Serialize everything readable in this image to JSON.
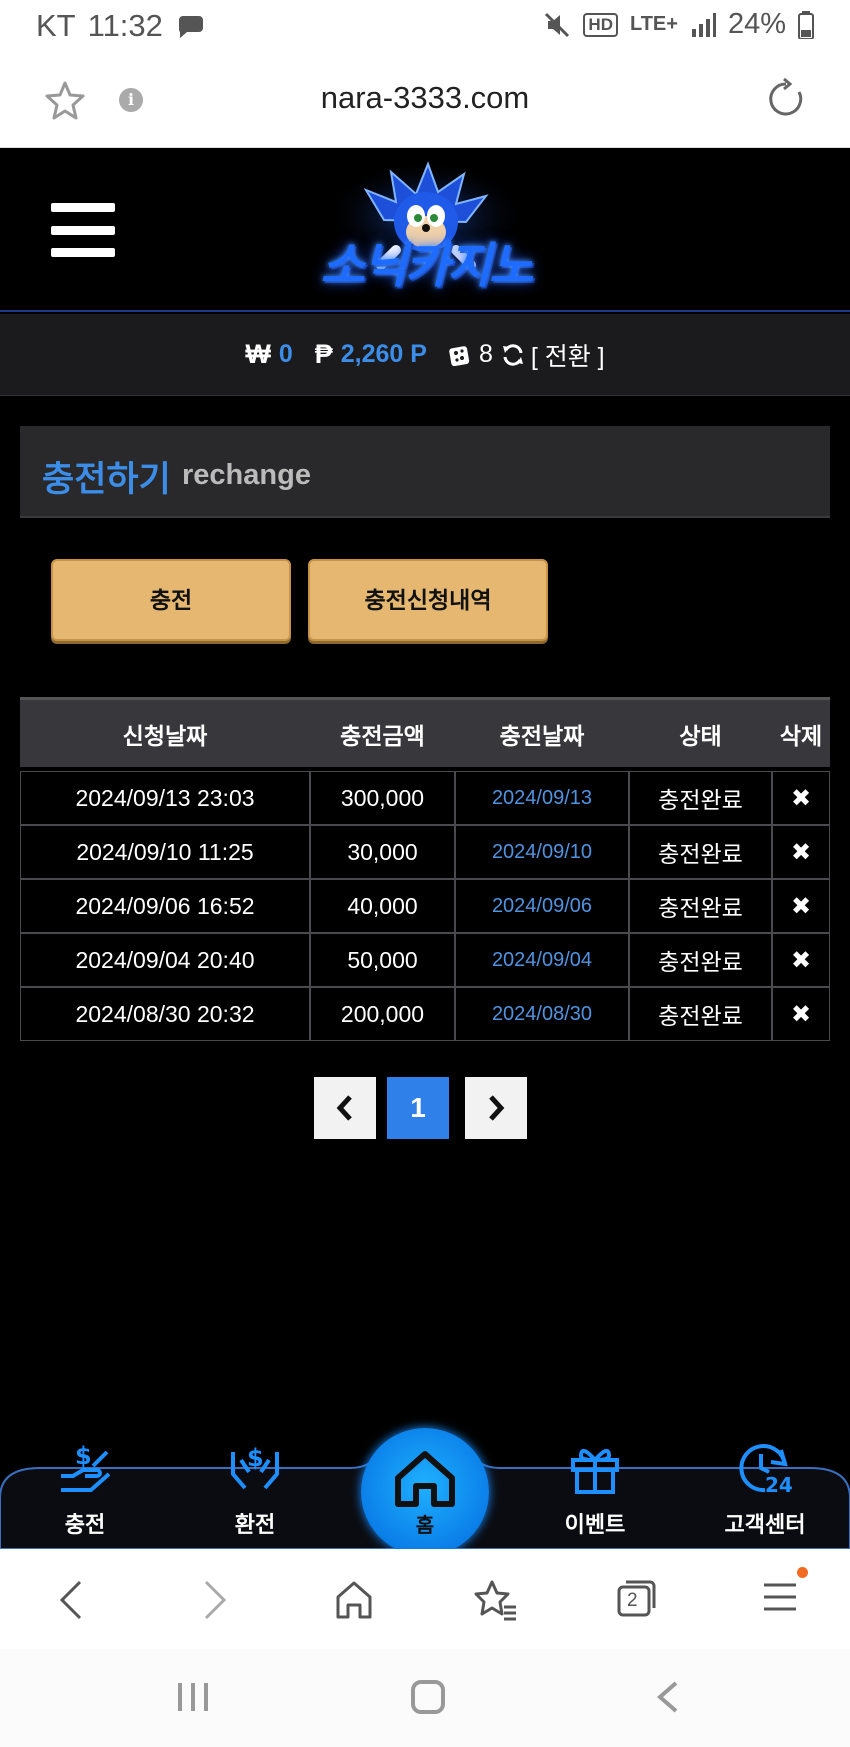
{
  "status_bar": {
    "carrier": "KT",
    "time": "11:32",
    "battery": "24%",
    "network": "LTE+"
  },
  "browser": {
    "url": "nara-3333.com"
  },
  "site": {
    "logo_text": "소닉카지노"
  },
  "balance": {
    "won_symbol": "₩",
    "won_value": "0",
    "point_symbol": "₱",
    "point_value": "2,260 P",
    "ticket_value": "8",
    "swap_label": "[ 전환 ]"
  },
  "page": {
    "title": "충전하기",
    "subtitle": "rechange"
  },
  "actions": {
    "charge_label": "충전",
    "history_label": "충전신청내역"
  },
  "table": {
    "headers": [
      "신청날짜",
      "충전금액",
      "충전날짜",
      "상태",
      "삭제"
    ],
    "rows": [
      {
        "requested": "2024/09/13 23:03",
        "amount": "300,000",
        "charged": "2024/09/13",
        "status": "충전완료",
        "delete": "✖"
      },
      {
        "requested": "2024/09/10 11:25",
        "amount": "30,000",
        "charged": "2024/09/10",
        "status": "충전완료",
        "delete": "✖"
      },
      {
        "requested": "2024/09/06 16:52",
        "amount": "40,000",
        "charged": "2024/09/06",
        "status": "충전완료",
        "delete": "✖"
      },
      {
        "requested": "2024/09/04 20:40",
        "amount": "50,000",
        "charged": "2024/09/04",
        "status": "충전완료",
        "delete": "✖"
      },
      {
        "requested": "2024/08/30 20:32",
        "amount": "200,000",
        "charged": "2024/08/30",
        "status": "충전완료",
        "delete": "✖"
      }
    ]
  },
  "pagination": {
    "current_page": "1"
  },
  "bottom_nav": {
    "deposit": "충전",
    "withdraw": "환전",
    "home": "홈",
    "event": "이벤트",
    "support": "고객센터"
  },
  "browser_tabs_count": "2",
  "colors": {
    "accent_blue": "#3b8de8",
    "gold_button": "#e5b771",
    "page_active": "#2f80e8"
  }
}
